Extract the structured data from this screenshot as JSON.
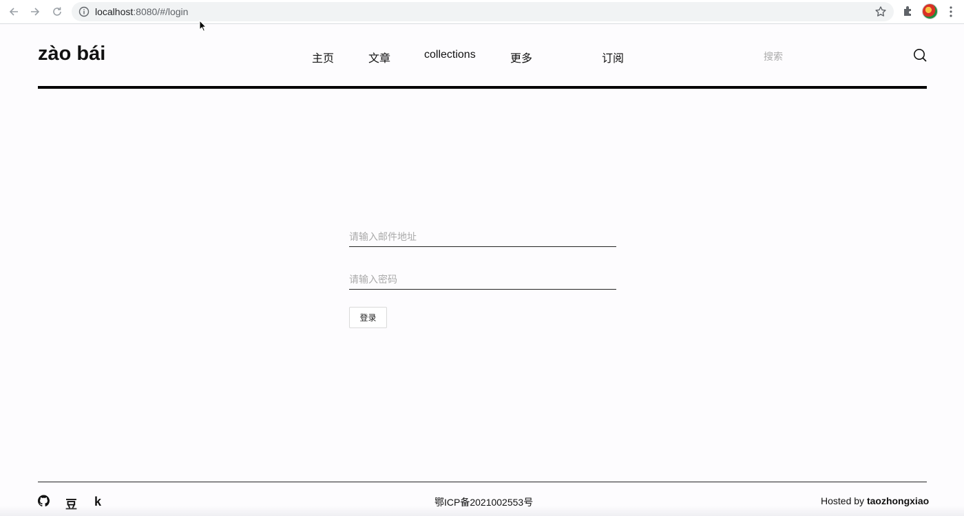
{
  "browser": {
    "url_host": "localhost",
    "url_rest": ":8080/#/login"
  },
  "header": {
    "logo": "zào bái",
    "nav": [
      "主页",
      "文章",
      "collections",
      "更多",
      "订阅"
    ],
    "search_placeholder": "搜索"
  },
  "login": {
    "email_placeholder": "请输入邮件地址",
    "password_placeholder": "请输入密码",
    "submit_label": "登录"
  },
  "footer": {
    "icons": [
      "github-icon",
      "douban-icon",
      "k-icon"
    ],
    "douban_glyph": "豆",
    "k_glyph": "k",
    "icp": "鄂ICP备2021002553号",
    "hosted_prefix": "Hosted by ",
    "hosted_name": "taozhongxiao"
  }
}
